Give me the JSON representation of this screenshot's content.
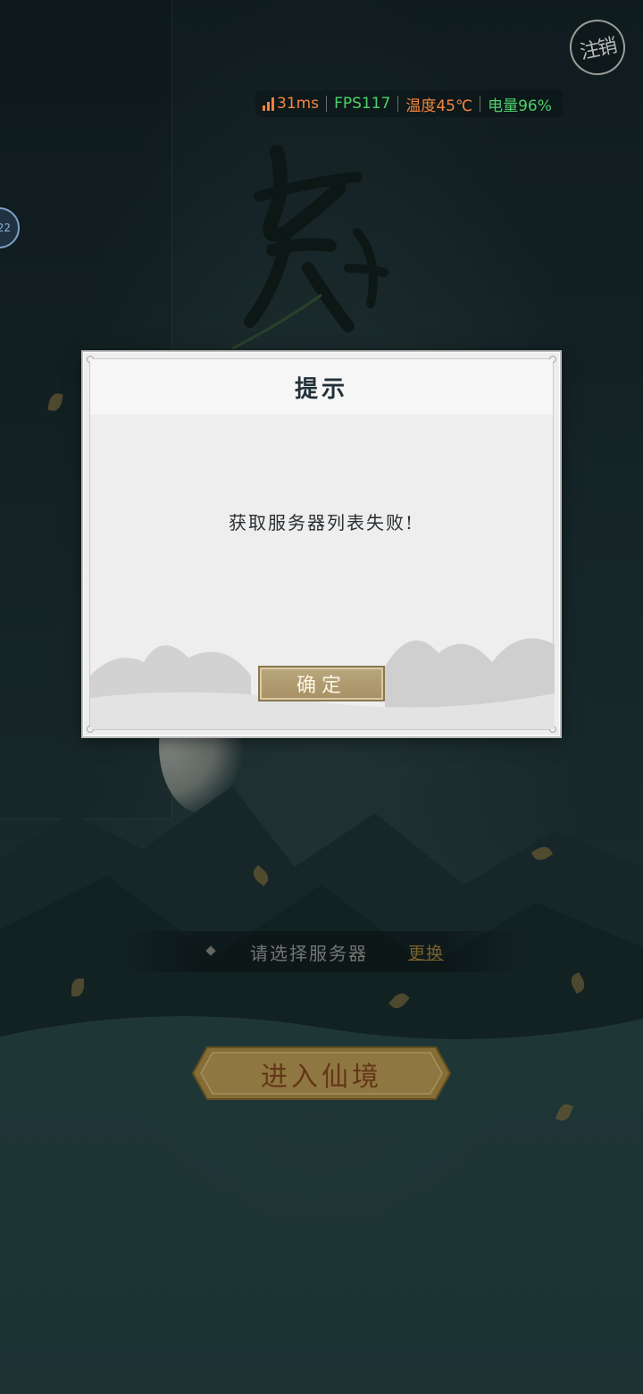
{
  "status_bar": {
    "ping": "31ms",
    "fps": "FPS117",
    "temperature": "温度45℃",
    "battery": "电量96%"
  },
  "logout_label": "注销",
  "side_bubble_text": "22",
  "dialog": {
    "title": "提示",
    "message": "获取服务器列表失败!",
    "confirm_label": "确定"
  },
  "server": {
    "label": "请选择服务器",
    "change_label": "更换"
  },
  "enter_button_label": "进入仙境",
  "colors": {
    "ping": "#f6853e",
    "fps": "#4dd26a",
    "temperature": "#f6853e",
    "battery": "#4dd26a",
    "gold": "#a8863f"
  }
}
